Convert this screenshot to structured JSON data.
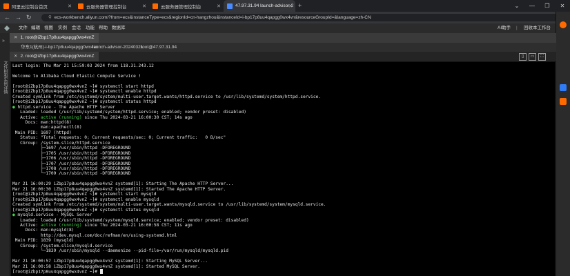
{
  "browser": {
    "tabs": [
      {
        "label": "阿里云控制台首页",
        "color": "#ff6a00"
      },
      {
        "label": "云服务器管理控制台",
        "color": "#ff6a00"
      },
      {
        "label": "云服务器管理控制台",
        "color": "#ff6a00"
      },
      {
        "label": "47.97.31.94 launch-advisor-2",
        "color": "#4a8cff",
        "active": true
      }
    ],
    "new_tab": "+",
    "controls": [
      "⌄",
      "—",
      "❐",
      "✕"
    ],
    "back": "←",
    "forward": "→",
    "reload": "↻",
    "url": "ecs-workbench.aliyun.com/?from=ecs&instanceType=ecs&regionId=cn-hangzhou&instanceId=i-bp17p8uu4qapgg0wx4vn&resourceGroupId=&language=zh-CN"
  },
  "menu": {
    "items": [
      "文件",
      "编辑",
      "视图",
      "实例",
      "会话",
      "功能",
      "帮助",
      "数据库"
    ],
    "ai_label": "AI助手",
    "back_label": "回收本工作台"
  },
  "left_strip": {
    "label": "文件树和实例详情"
  },
  "instance_tabs": [
    "华东1(杭州)-i-bp17p8uu4qapgg0wx4vn",
    "launch-advisor-20240321",
    "root@47.97.31.94"
  ],
  "session_tab": "1. root@iZbp17p8uu4qapgg0wx4vnZ",
  "session_title": "2. root@iZbp17p8uu4qapgg0wx4vnZ",
  "terminal": {
    "lines": [
      "Last login: Thu Mar 21 15:59:03 2024 from 118.31.243.12",
      "",
      "Welcome to Alibaba Cloud Elastic Compute Service !",
      "",
      "[root@iZbp17p8uu4qapgg0wx4vnZ ~]# systemctl start httpd",
      "[root@iZbp17p8uu4qapgg0wx4vnZ ~]# systemctl enable httpd",
      "Created symlink from /etc/systemd/system/multi-user.target.wants/httpd.service to /usr/lib/systemd/system/httpd.service.",
      "[root@iZbp17p8uu4qapgg0wx4vnZ ~]# systemctl status httpd",
      "● httpd.service - The Apache HTTP Server",
      "   Loaded: loaded (/usr/lib/systemd/system/httpd.service; enabled; vendor preset: disabled)",
      "   Active: active (running) since Thu 2024-03-21 16:00:30 CST; 14s ago",
      "     Docs: man:httpd(8)",
      "           man:apachectl(8)",
      " Main PID: 1697 (httpd)",
      "   Status: \"Total requests: 0; Current requests/sec: 0; Current traffic:   0 B/sec\"",
      "   CGroup: /system.slice/httpd.service",
      "           ├─1697 /usr/sbin/httpd -DFOREGROUND",
      "           ├─1705 /usr/sbin/httpd -DFOREGROUND",
      "           ├─1706 /usr/sbin/httpd -DFOREGROUND",
      "           ├─1707 /usr/sbin/httpd -DFOREGROUND",
      "           ├─1708 /usr/sbin/httpd -DFOREGROUND",
      "           └─1709 /usr/sbin/httpd -DFOREGROUND",
      "",
      "Mar 21 16:00:29 iZbp17p8uu4qapgg0wx4vnZ systemd[1]: Starting The Apache HTTP Server...",
      "Mar 21 16:00:30 iZbp17p8uu4qapgg0wx4vnZ systemd[1]: Started The Apache HTTP Server.",
      "[root@iZbp17p8uu4qapgg0wx4vnZ ~]# systemctl start mysqld",
      "[root@iZbp17p8uu4qapgg0wx4vnZ ~]# systemctl enable mysqld",
      "Created symlink from /etc/systemd/system/multi-user.target.wants/mysqld.service to /usr/lib/systemd/system/mysqld.service.",
      "[root@iZbp17p8uu4qapgg0wx4vnZ ~]# systemctl status mysqld",
      "● mysqld.service - MySQL Server",
      "   Loaded: loaded (/usr/lib/systemd/system/mysqld.service; enabled; vendor preset: disabled)",
      "   Active: active (running) since Thu 2024-03-21 16:00:58 CST; 11s ago",
      "     Docs: man:mysqld(8)",
      "           http://dev.mysql.com/doc/refman/en/using-systemd.html",
      " Main PID: 1839 (mysqld)",
      "   CGroup: /system.slice/mysqld.service",
      "           └─1839 /usr/sbin/mysqld --daemonize --pid-file=/var/run/mysqld/mysqld.pid",
      "",
      "Mar 21 16:00:57 iZbp17p8uu4qapgg0wx4vnZ systemd[1]: Starting MySQL Server...",
      "Mar 21 16:00:58 iZbp17p8uu4qapgg0wx4vnZ systemd[1]: Started MySQL Server.",
      "[root@iZbp17p8uu4qapgg0wx4vnZ ~]# "
    ]
  }
}
